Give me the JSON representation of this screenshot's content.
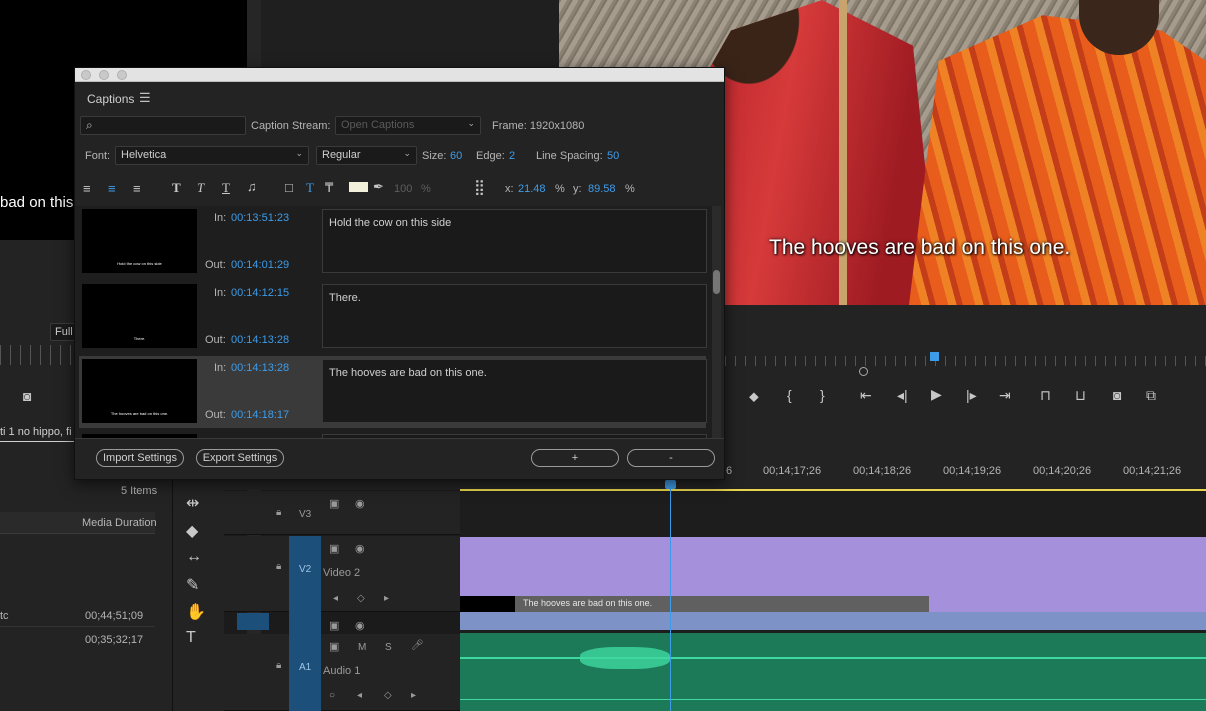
{
  "dialog": {
    "tab": "Captions",
    "caption_stream_label": "Caption Stream:",
    "caption_stream_value": "Open Captions",
    "frame": "Frame: 1920x1080",
    "font_label": "Font:",
    "font_value": "Helvetica",
    "style_value": "Regular",
    "size_label": "Size:",
    "size_value": "60",
    "edge_label": "Edge:",
    "edge_value": "2",
    "line_spacing_label": "Line Spacing:",
    "line_spacing_value": "50",
    "opacity_value": "100",
    "percent": "%",
    "x_label": "x:",
    "x_value": "21.48",
    "y_label": "y:",
    "y_value": "89.58",
    "in_label": "In:",
    "out_label": "Out:",
    "captions": [
      {
        "in": "00:13:51:23",
        "out": "00:14:01:29",
        "text": "Hold the cow on this side"
      },
      {
        "in": "00:14:12:15",
        "out": "00:14:13:28",
        "text": "There."
      },
      {
        "in": "00:14:13:28",
        "out": "00:14:18:17",
        "text": "The hooves are bad on this one."
      }
    ],
    "import_label": "Import Settings",
    "export_label": "Export Settings",
    "add_label": "+",
    "remove_label": "-"
  },
  "program": {
    "subtitle": "The hooves are bad on this one.",
    "left_subtitle": "bad on this",
    "full_label": "Full",
    "sequence_tab": "ti 1 no hippo, fi"
  },
  "project": {
    "items_count": "5 Items",
    "media_duration_label": "Media Duration",
    "row1_name": "tc",
    "row1_duration": "00;44;51;09",
    "row2_duration": "00;35;32;17"
  },
  "timeline": {
    "ticks": [
      "6",
      "00;14;17;26",
      "00;14;18;26",
      "00;14;19;26",
      "00;14;20;26",
      "00;14;21;26"
    ],
    "v3": "V3",
    "v2": "V2",
    "video2": "Video 2",
    "a1": "A1",
    "audio1": "Audio 1",
    "m": "M",
    "s": "S",
    "clip_caption": "The hooves are bad on this one."
  }
}
